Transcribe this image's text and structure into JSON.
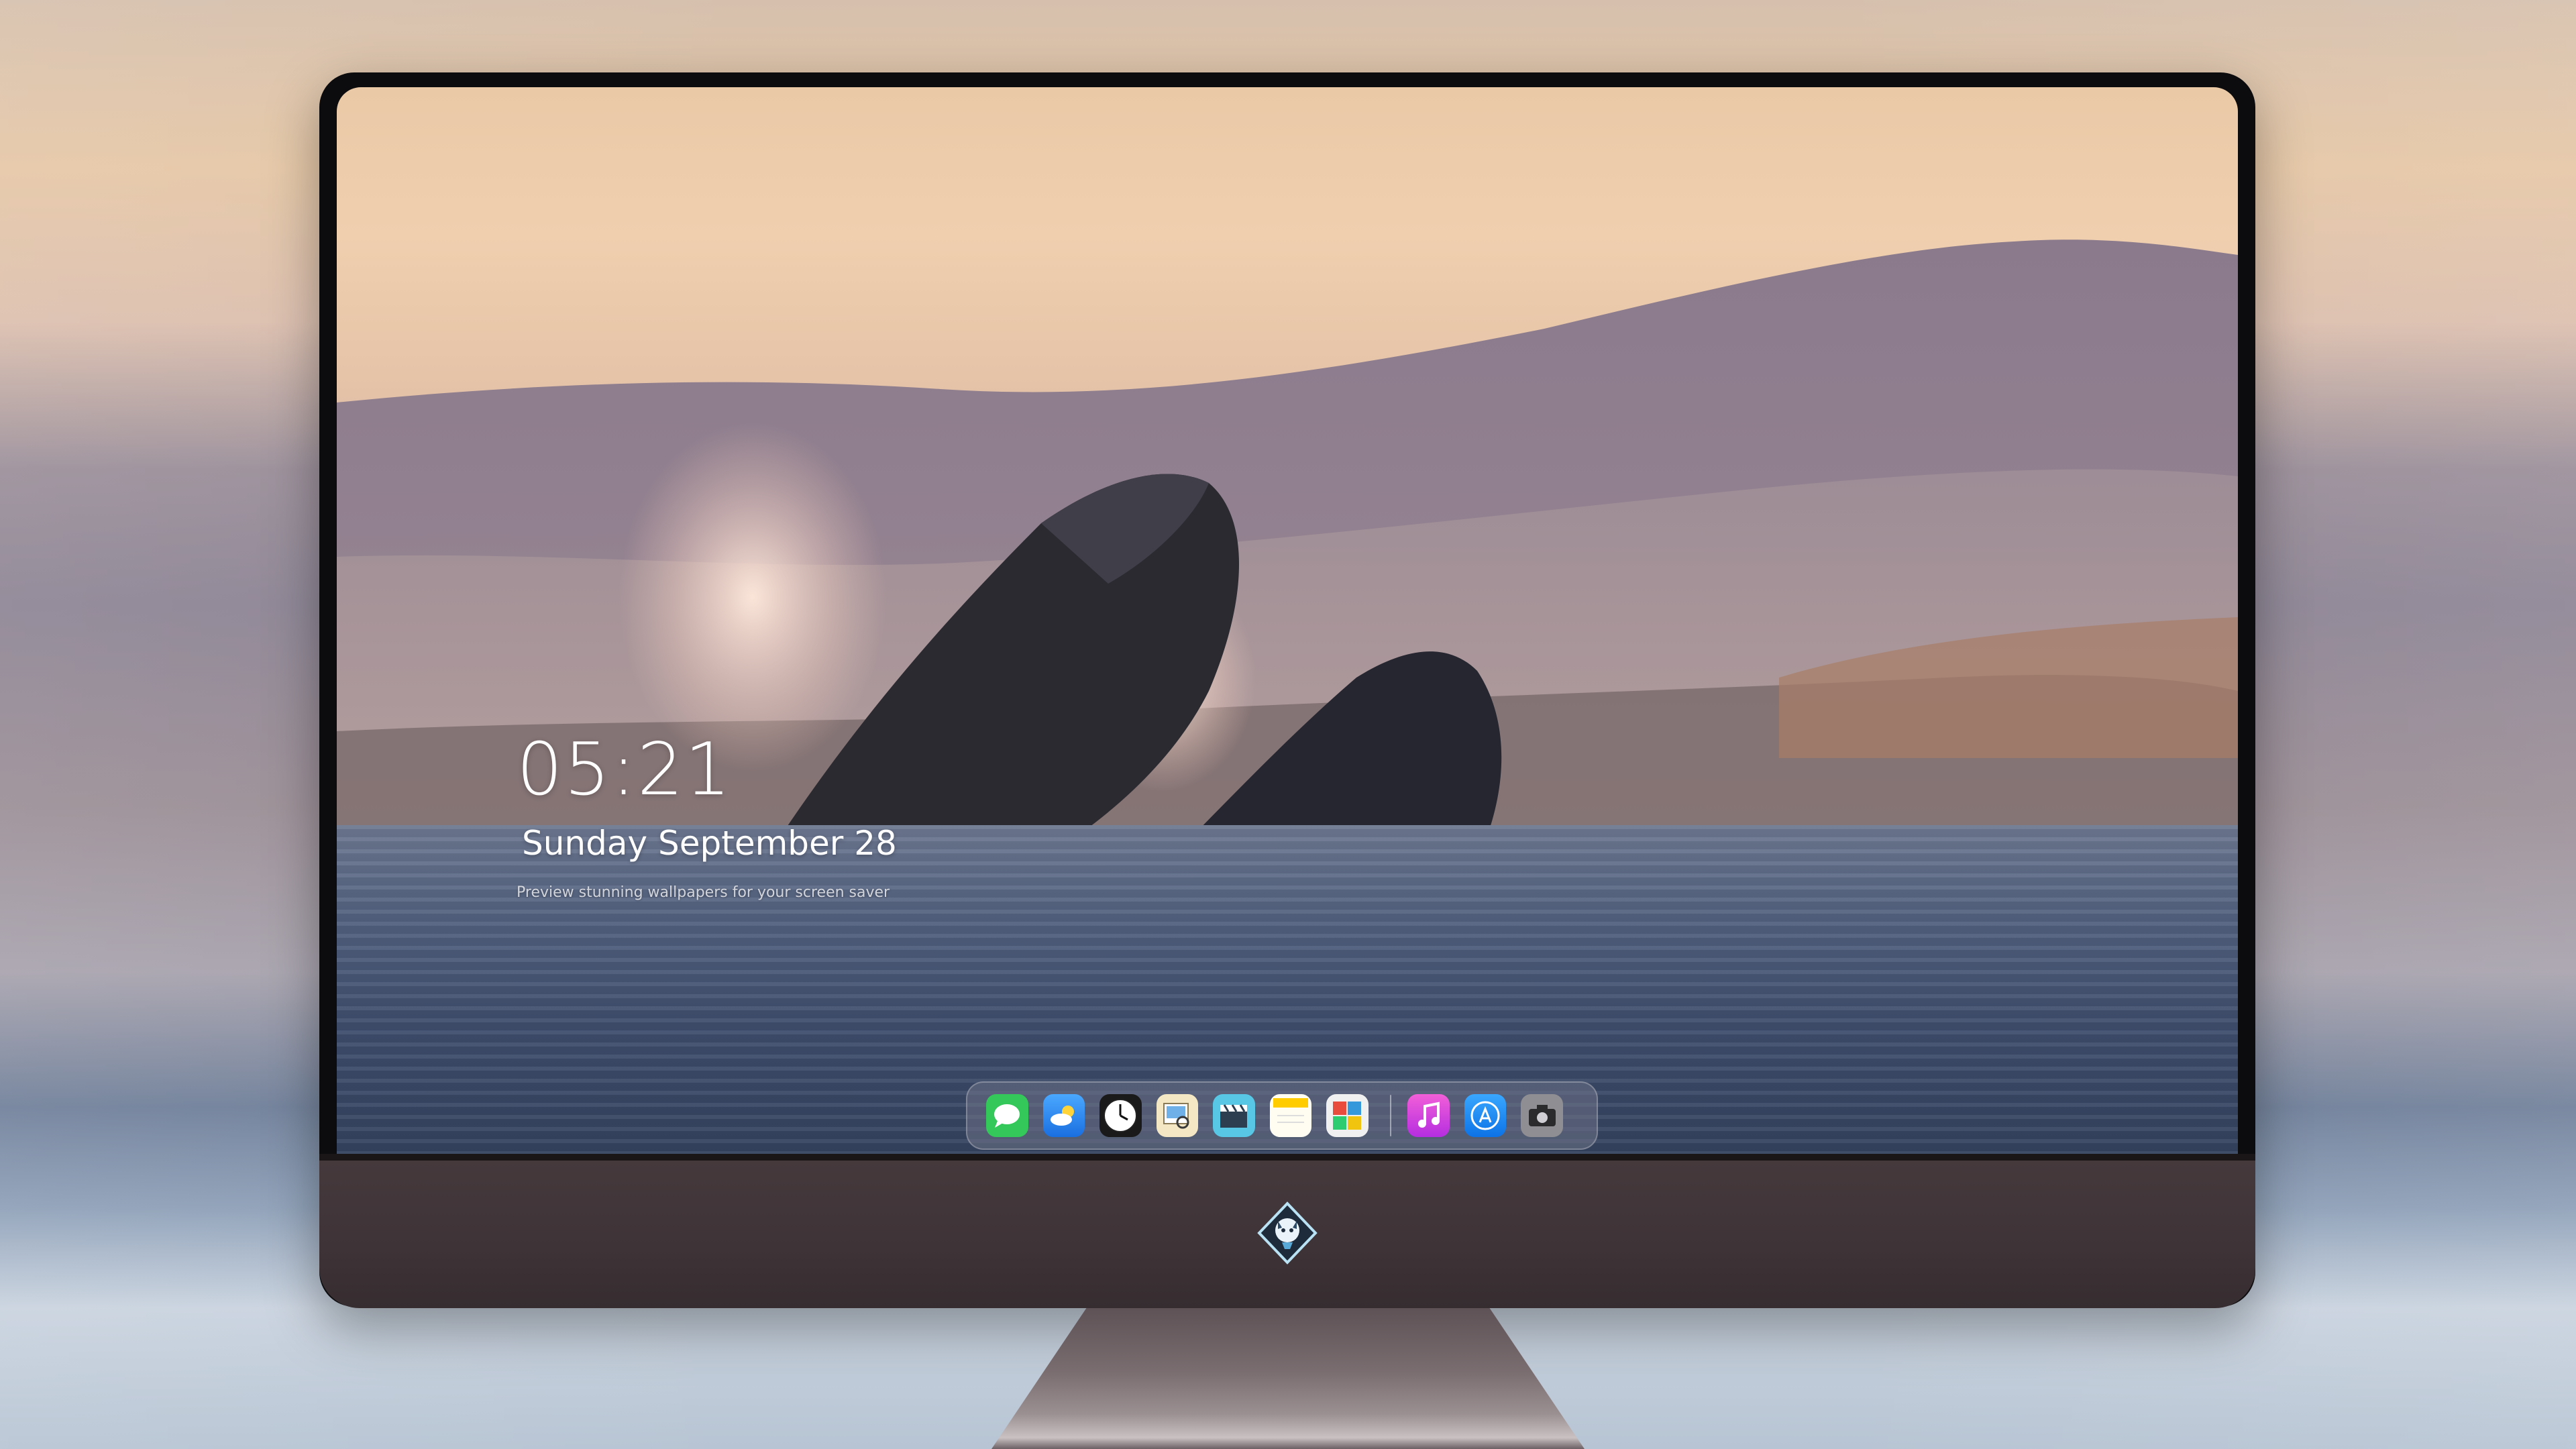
{
  "lock_screen": {
    "time": "05:21",
    "date": "Sunday September 28",
    "tagline": "Preview stunning wallpapers for your screen saver"
  },
  "dock": {
    "apps": [
      {
        "id": "messages",
        "icon": "messages-icon",
        "color": "#34c759"
      },
      {
        "id": "weather",
        "icon": "weather-icon",
        "color": "#2a8df5"
      },
      {
        "id": "clock",
        "icon": "clock-icon",
        "color": "#111111"
      },
      {
        "id": "preview",
        "icon": "preview-icon",
        "color": "#e8d6a2"
      },
      {
        "id": "clips",
        "icon": "clapper-icon",
        "color": "#58c7e6"
      },
      {
        "id": "notes",
        "icon": "notes-icon",
        "color": "#ffd43b"
      },
      {
        "id": "photo-booth",
        "icon": "photo-gallery-icon",
        "color": "#f0f0f0"
      },
      {
        "id": "music",
        "icon": "music-icon",
        "color": "#e043d4"
      },
      {
        "id": "app-store",
        "icon": "app-store-icon",
        "color": "#1b8cf2"
      },
      {
        "id": "camera",
        "icon": "camera-icon",
        "color": "#8e8e93"
      }
    ]
  },
  "colors": {
    "sky_top": "#e9c9a6",
    "water_dark": "#34425f",
    "monitor_chin": "#3e3337"
  }
}
